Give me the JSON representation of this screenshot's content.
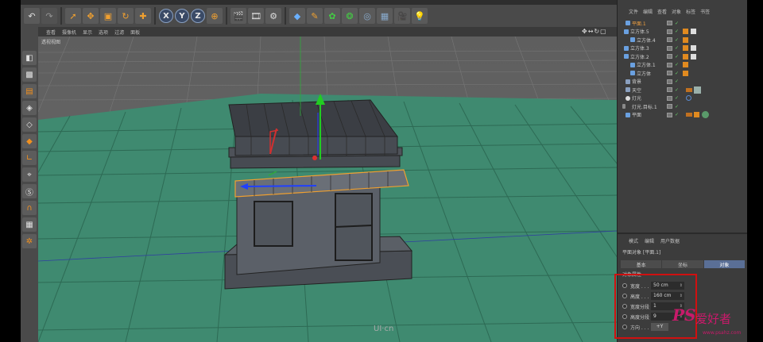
{
  "toolbar": {
    "buttons": [
      "undo-icon",
      "redo-icon",
      "select-arrow-icon",
      "move-icon",
      "scale-icon",
      "rotate-icon",
      "add-icon"
    ],
    "axes": [
      "X",
      "Y",
      "Z"
    ],
    "render": [
      "world-coordinates-icon",
      "render-view-icon",
      "render-picture-icon",
      "render-settings-icon"
    ],
    "objects": [
      "cube-icon",
      "pen-icon",
      "subdivision-icon",
      "array-icon",
      "deformer-icon",
      "floor-icon",
      "camera-icon",
      "light-icon"
    ]
  },
  "viewport": {
    "menus": [
      "查看",
      "摄像机",
      "显示",
      "选项",
      "过滤",
      "面板"
    ],
    "label": "透视视图",
    "nav_icons": "✥↔↻▢"
  },
  "object_manager": {
    "menus": [
      "文件",
      "编辑",
      "查看",
      "对象",
      "标签",
      "书签"
    ],
    "items": [
      {
        "name": "平面.1",
        "selected": true
      },
      {
        "name": "立方体.5",
        "selected": false
      },
      {
        "name": "立方体.4",
        "selected": false
      },
      {
        "name": "立方体.3",
        "selected": false
      },
      {
        "name": "立方体.2",
        "selected": false
      },
      {
        "name": "立方体.1",
        "selected": false
      },
      {
        "name": "立方体",
        "selected": false
      },
      {
        "name": "背景",
        "selected": false
      },
      {
        "name": "天空",
        "selected": false
      },
      {
        "name": "灯光",
        "selected": false
      },
      {
        "name": "灯光.目标.1",
        "selected": false
      },
      {
        "name": "平面",
        "selected": false
      }
    ]
  },
  "attributes": {
    "menus": [
      "模式",
      "编辑",
      "用户数据"
    ],
    "title": "平面对象 [平面.1]",
    "tabs": [
      "基本",
      "坐标",
      "对象"
    ],
    "active_tab": "对象",
    "section": "对象属性",
    "fields": [
      {
        "label": "宽度 . . . . .",
        "value": "50 cm"
      },
      {
        "label": "高度 . . . . .",
        "value": "160 cm"
      },
      {
        "label": "宽度分段",
        "value": "1"
      },
      {
        "label": "高度分段",
        "value": "9"
      }
    ],
    "direction_label": "方向 . . . . . .",
    "direction_value": "+Y"
  },
  "watermark": {
    "logo": "PS",
    "text": "爱好者",
    "url": "www.psahz.com",
    "uicn": "UI·cn"
  },
  "colors": {
    "accent": "#5a6f96",
    "selected_text": "#f0a040",
    "highlight_box": "#d01010",
    "ground": "#3f8a70"
  }
}
